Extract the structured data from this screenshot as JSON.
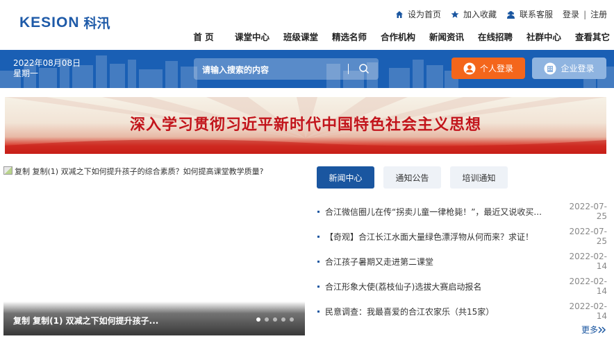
{
  "header": {
    "logo_en": "KESION",
    "logo_cn": "科汛",
    "toplinks": {
      "home": "设为首页",
      "favorite": "加入收藏",
      "service": "联系客服"
    },
    "login": "登录",
    "separator": "|",
    "register": "注册"
  },
  "nav": {
    "items": [
      "首 页",
      "课堂中心",
      "班级课堂",
      "精选名师",
      "合作机构",
      "新闻资讯",
      "在线招聘",
      "社群中心",
      "查看其它"
    ]
  },
  "bluebar": {
    "date": "2022年08月08日",
    "weekday": "星期一",
    "search_placeholder": "请输入搜索的内容",
    "personal_login": "个人登录",
    "company_login": "企业登录"
  },
  "banner": {
    "text": "深入学习贯彻习近平新时代中国特色社会主义思想"
  },
  "slider": {
    "image_alt": "复制 复制(1) 双减之下如何提升孩子的综合素质？如何提高课堂教学质量?",
    "caption": "复制 复制(1) 双减之下如何提升孩子...",
    "dot_count": 5,
    "active_dot": 1
  },
  "news": {
    "tabs": [
      "新闻中心",
      "通知公告",
      "培训通知"
    ],
    "active_tab": "新闻中心",
    "items": [
      {
        "title": "合江微信圈儿在传“拐卖儿童一律枪毙！”，最近又说收买...",
        "date": "2022-07-25"
      },
      {
        "title": "【奇观】合江长江水面大量绿色漂浮物从何而来？求证！",
        "date": "2022-07-25"
      },
      {
        "title": "合江孩子暑期又走进第二课堂",
        "date": "2022-02-14"
      },
      {
        "title": "合江形象大使(荔枝仙子)选拔大赛启动报名",
        "date": "2022-02-14"
      },
      {
        "title": "民意调查：我最喜爱的合江农家乐（共15家）",
        "date": "2022-02-14"
      }
    ],
    "more": "更多"
  },
  "colors": {
    "brand_blue": "#1a5fb4",
    "orange": "#f4661b",
    "light_blue": "#8fb4e0",
    "banner_red": "#c2141b"
  },
  "icons": {
    "home": "home-icon",
    "favorite": "star-icon",
    "service": "customer-service-icon",
    "search": "search-icon",
    "personal": "user-icon",
    "company": "building-icon",
    "more": "double-chevron-right-icon"
  }
}
